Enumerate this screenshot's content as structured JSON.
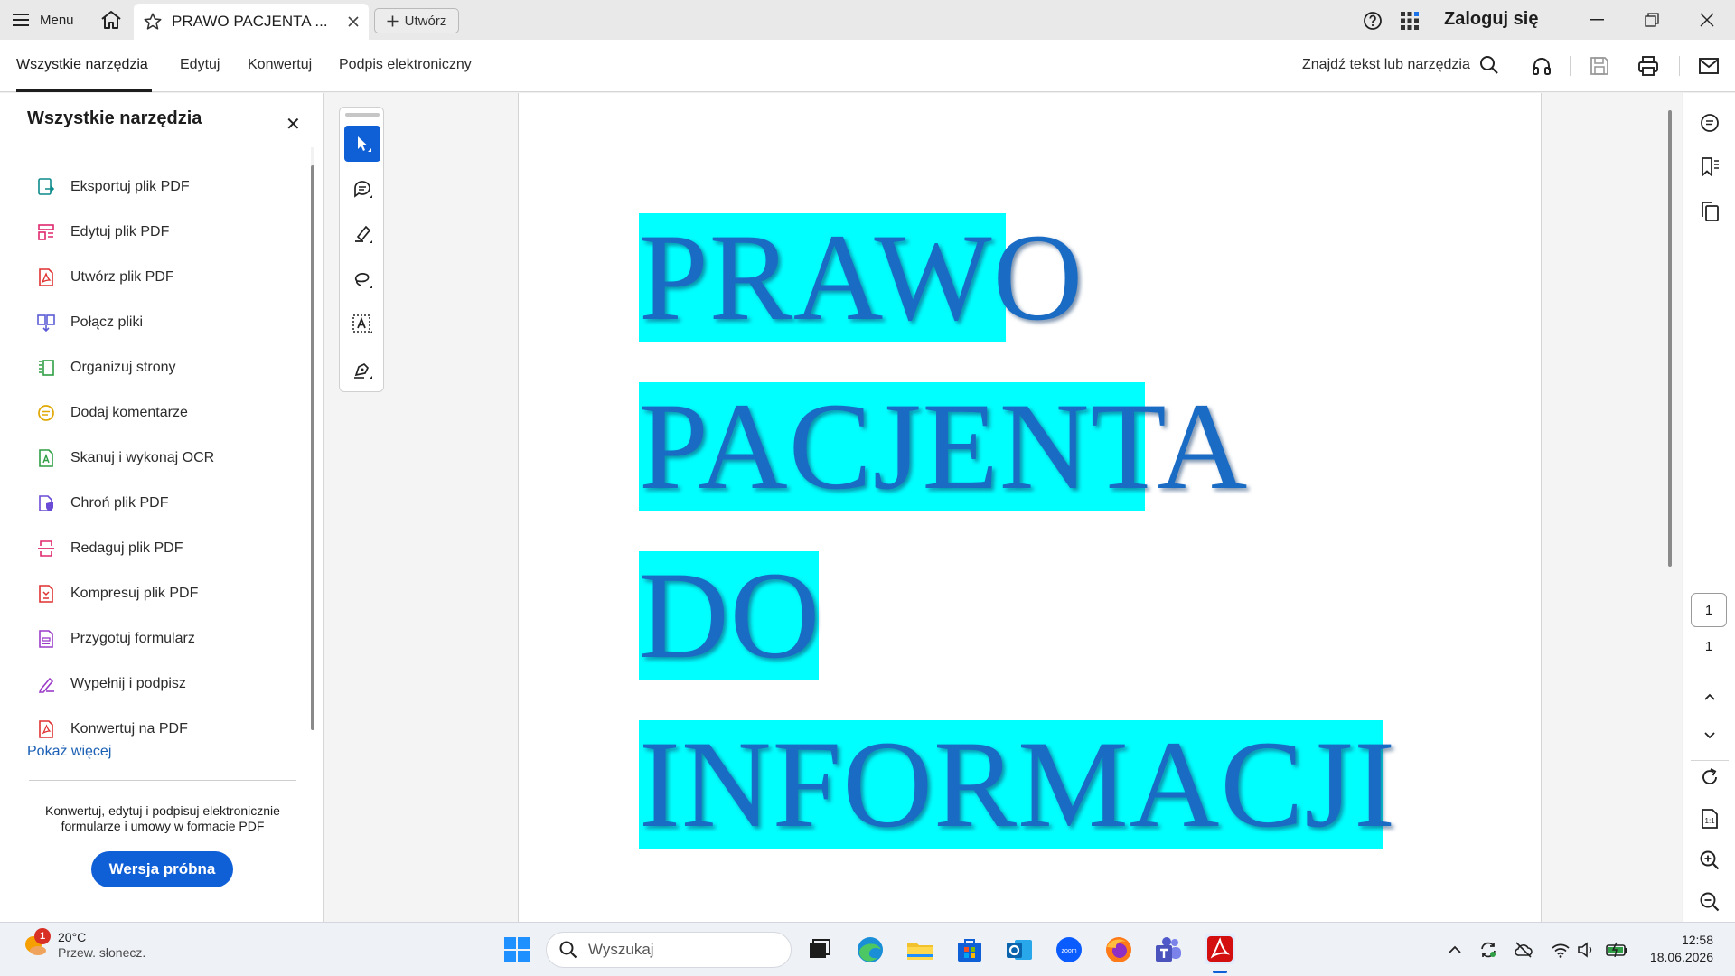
{
  "titlebar": {
    "menu_label": "Menu",
    "tab_title": "PRAWO PACJENTA ...",
    "create_label": "Utwórz",
    "login_label": "Zaloguj się"
  },
  "toolbar": {
    "tabs": [
      "Wszystkie narzędzia",
      "Edytuj",
      "Konwertuj",
      "Podpis elektroniczny"
    ],
    "active_tab": "Wszystkie narzędzia",
    "find_label": "Znajdź tekst lub narzędzia"
  },
  "leftpanel": {
    "title": "Wszystkie narzędzia",
    "items": [
      {
        "label": "Eksportuj plik PDF",
        "icon": "export-pdf-icon",
        "color": "#0d8a8a"
      },
      {
        "label": "Edytuj plik PDF",
        "icon": "edit-pdf-icon",
        "color": "#e0286d"
      },
      {
        "label": "Utwórz plik PDF",
        "icon": "create-pdf-icon",
        "color": "#e03131"
      },
      {
        "label": "Połącz pliki",
        "icon": "combine-files-icon",
        "color": "#5b5bd6"
      },
      {
        "label": "Organizuj strony",
        "icon": "organize-pages-icon",
        "color": "#2f9e44"
      },
      {
        "label": "Dodaj komentarze",
        "icon": "comment-icon",
        "color": "#e0a800"
      },
      {
        "label": "Skanuj i wykonaj OCR",
        "icon": "scan-ocr-icon",
        "color": "#2f9e44"
      },
      {
        "label": "Chroń plik PDF",
        "icon": "protect-pdf-icon",
        "color": "#6a4bd6"
      },
      {
        "label": "Redaguj plik PDF",
        "icon": "redact-pdf-icon",
        "color": "#e0286d"
      },
      {
        "label": "Kompresuj plik PDF",
        "icon": "compress-pdf-icon",
        "color": "#e03131"
      },
      {
        "label": "Przygotuj formularz",
        "icon": "prepare-form-icon",
        "color": "#9b3cc9"
      },
      {
        "label": "Wypełnij i podpisz",
        "icon": "fill-sign-icon",
        "color": "#9b3cc9"
      },
      {
        "label": "Konwertuj na PDF",
        "icon": "convert-pdf-icon",
        "color": "#e03131"
      }
    ],
    "show_more": "Pokaż więcej",
    "promo_text": "Konwertuj, edytuj i podpisuj elektronicznie formularze i umowy w formacie PDF",
    "trial_button": "Wersja próbna"
  },
  "document": {
    "lines": [
      "PRAWO",
      "PACJENTA",
      "DO",
      "INFORMACJI"
    ],
    "highlight_color": "#00ffff",
    "text_color": "#1a6bc4"
  },
  "pager": {
    "current_page": "1",
    "total_pages": "1"
  },
  "taskbar": {
    "weather_badge": "1",
    "temperature": "20°C",
    "weather_desc": "Przew. słonecz.",
    "search_placeholder": "Wyszukaj",
    "time": "12:58",
    "date": "18.06.2026"
  },
  "colors": {
    "accent": "#0f5fd7",
    "link": "#1a5fb4"
  }
}
